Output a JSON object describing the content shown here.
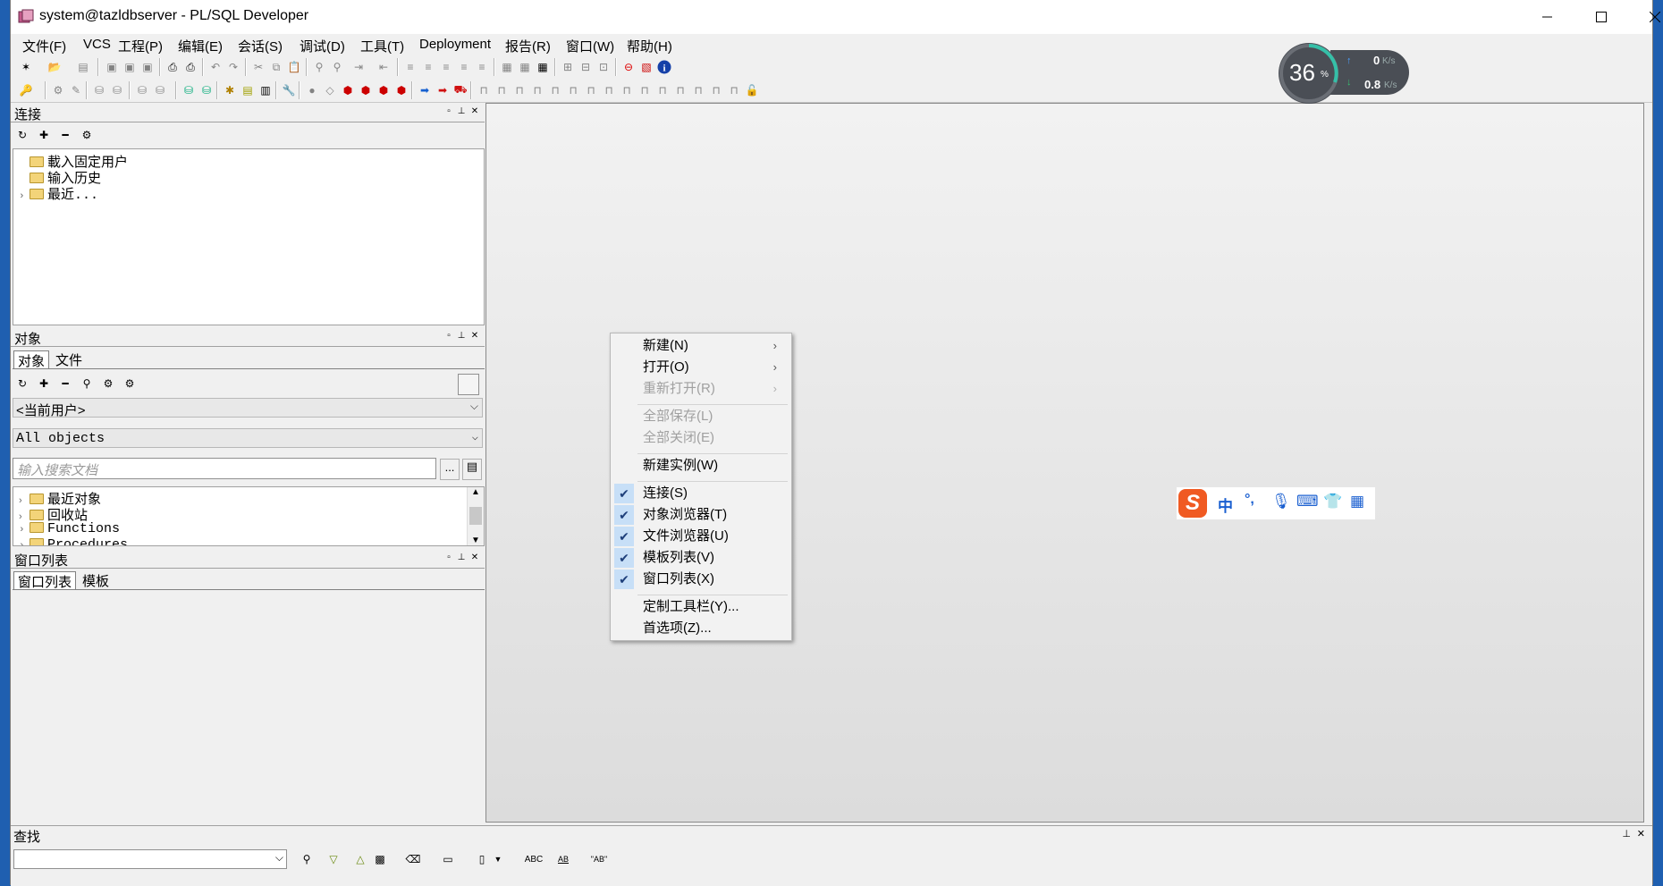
{
  "window": {
    "title": "system@tazldbserver - PL/SQL Developer"
  },
  "menus": [
    "文件(F)",
    "VCS",
    "工程(P)",
    "编辑(E)",
    "会话(S)",
    "调试(D)",
    "工具(T)",
    "Deployment",
    "报告(R)",
    "窗口(W)",
    "帮助(H)"
  ],
  "connection_panel": {
    "title": "连接",
    "items": [
      "載入固定用户",
      "输入历史",
      "最近..."
    ]
  },
  "objects_panel": {
    "title": "对象",
    "tabs": [
      "对象",
      "文件"
    ],
    "user_filter": "<当前用户>",
    "object_filter": "All objects",
    "search_placeholder": "输入搜索文档",
    "search_more": "...",
    "items": [
      "最近对象",
      "回收站",
      "Functions",
      "Procedures"
    ]
  },
  "window_list_panel": {
    "title": "窗口列表",
    "tabs": [
      "窗口列表",
      "模板"
    ]
  },
  "context_menu": {
    "new": "新建(N)",
    "open": "打开(O)",
    "reopen": "重新打开(R)",
    "save_all": "全部保存(L)",
    "close_all": "全部关闭(E)",
    "new_instance": "新建实例(W)",
    "connection": "连接(S)",
    "object_browser": "对象浏览器(T)",
    "file_browser": "文件浏览器(U)",
    "template_list": "模板列表(V)",
    "window_list": "窗口列表(X)",
    "customize_toolbar": "定制工具栏(Y)...",
    "preferences": "首选项(Z)..."
  },
  "net_monitor": {
    "cpu": "36",
    "cpu_unit": "%",
    "up": "0",
    "up_unit": "K/s",
    "down": "0.8",
    "down_unit": "K/s"
  },
  "ime_toolbar": {
    "logo": "S",
    "mode": "中",
    "punct": "°,"
  },
  "find_bar": {
    "title": "查找",
    "search_value": "",
    "abc_label": "ABC",
    "ab_label": "AB",
    "word_label": "\"AB\""
  },
  "colors": {
    "accent": "#1e3f7a",
    "check_bg": "#c7dff7",
    "desktop": "#1f5fb0",
    "ime_orange": "#f05a22"
  }
}
